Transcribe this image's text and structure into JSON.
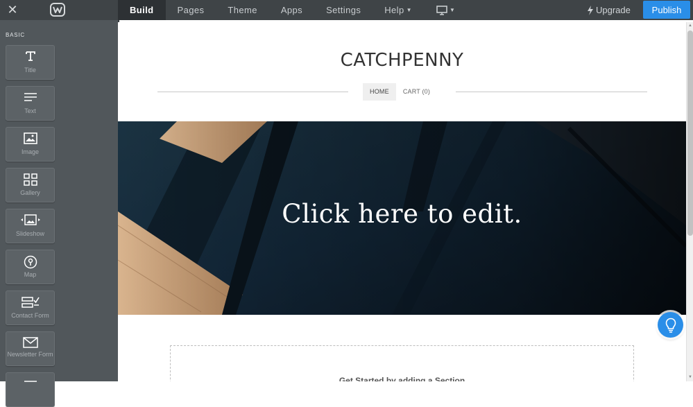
{
  "topbar": {
    "close_icon": "close-icon",
    "logo_icon": "weebly-logo-icon",
    "nav": [
      {
        "label": "Build",
        "active": true
      },
      {
        "label": "Pages",
        "active": false
      },
      {
        "label": "Theme",
        "active": false
      },
      {
        "label": "Apps",
        "active": false
      },
      {
        "label": "Settings",
        "active": false
      },
      {
        "label": "Help",
        "active": false,
        "dropdown": true
      }
    ],
    "device_icon": "desktop-monitor-icon",
    "upgrade_label": "Upgrade",
    "publish_label": "Publish"
  },
  "sidebar": {
    "heading": "BASIC",
    "tiles": [
      {
        "label": "Title",
        "icon": "title-icon"
      },
      {
        "label": "Text",
        "icon": "text-lines-icon"
      },
      {
        "label": "Image",
        "icon": "image-icon"
      },
      {
        "label": "Gallery",
        "icon": "gallery-grid-icon"
      },
      {
        "label": "Slideshow",
        "icon": "slideshow-icon"
      },
      {
        "label": "Map",
        "icon": "map-pin-icon"
      },
      {
        "label": "Contact Form",
        "icon": "contact-form-icon"
      },
      {
        "label": "Newsletter Form",
        "icon": "envelope-icon"
      }
    ]
  },
  "site": {
    "title": "CATCHPENNY",
    "nav": [
      {
        "label": "HOME",
        "active": true
      },
      {
        "label": "CART (0)",
        "active": false
      }
    ],
    "hero_text": "Click here to edit.",
    "section_prompt": "Get Started by adding a Section"
  },
  "colors": {
    "topbar_bg": "#3f4447",
    "sidebar_bg": "#51575b",
    "publish_blue": "#2a8ee8",
    "hero_dark": "#12202c"
  },
  "help_icon": "lightbulb-icon"
}
